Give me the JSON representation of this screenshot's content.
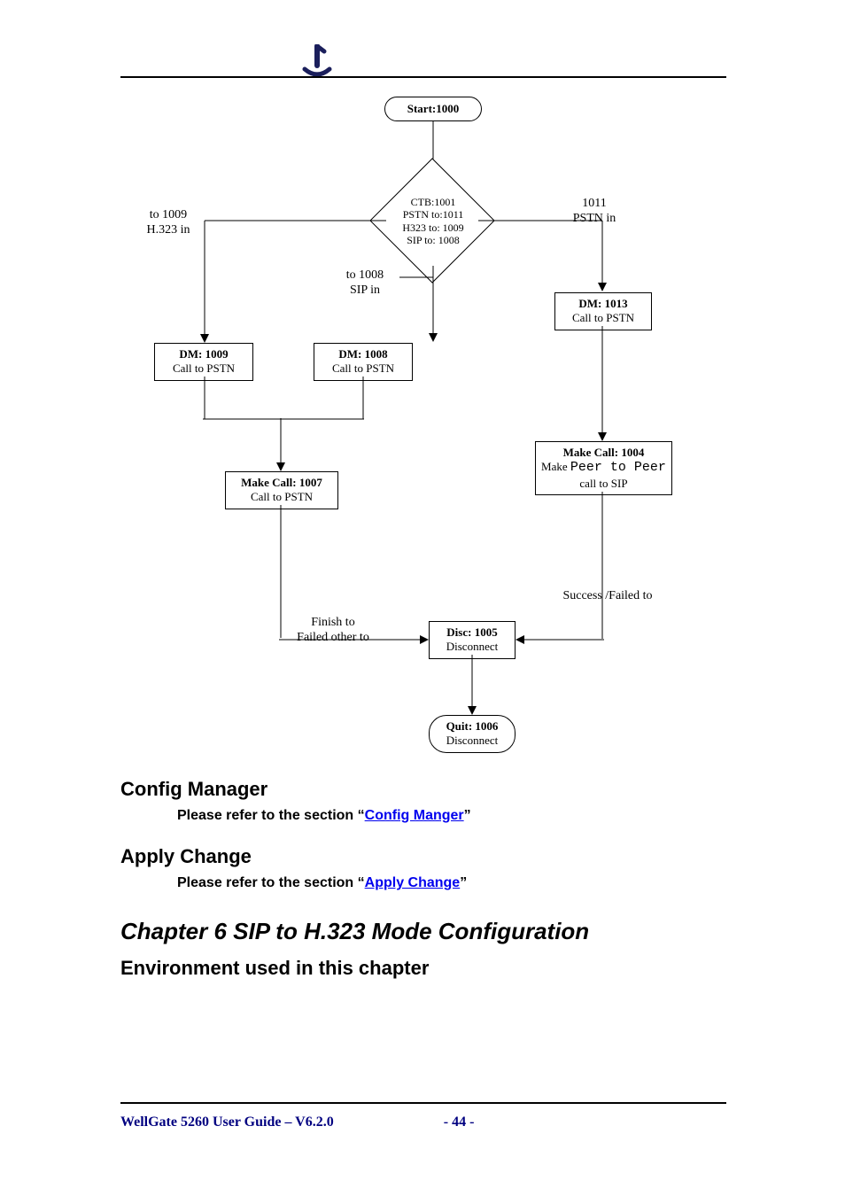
{
  "diagram": {
    "start": {
      "l1": "Start:1000"
    },
    "ctb": {
      "l1": "CTB:1001",
      "l2": "PSTN to:1011",
      "l3": "H323 to: 1009",
      "l4": "SIP to: 1008"
    },
    "to1009": {
      "l1": "to 1009",
      "l2": "H.323 in"
    },
    "to1008": {
      "l1": "to 1008",
      "l2": "SIP in"
    },
    "pstn1011": {
      "l1": "1011",
      "l2": "PSTN in"
    },
    "dm1013": {
      "l1": "DM: 1013",
      "l2": "Call to PSTN"
    },
    "dm1009": {
      "l1": "DM: 1009",
      "l2": "Call to PSTN"
    },
    "dm1008": {
      "l1": "DM: 1008",
      "l2": "Call to PSTN"
    },
    "make1004": {
      "l1": "Make Call: 1004",
      "l2a": "Make",
      "l2b": "Peer to Peer",
      "l3": "call to SIP"
    },
    "make1007": {
      "l1": "Make Call: 1007",
      "l2": "Call to PSTN"
    },
    "finish": {
      "l1": "Finish to",
      "l2": "Failed other to"
    },
    "disc1005": {
      "l1": "Disc: 1005",
      "l2": "Disconnect"
    },
    "quit1006": {
      "l1": "Quit: 1006",
      "l2": "Disconnect"
    },
    "success": {
      "l1": "Success /Failed to"
    }
  },
  "sections": {
    "config_manager_h": "Config Manager",
    "config_manager_pre": "Please refer to the section “",
    "config_manager_link": "Config Manger",
    "config_manager_post": "”",
    "apply_change_h": "Apply Change",
    "apply_change_pre": "Please refer to the section “",
    "apply_change_link": "Apply Change",
    "apply_change_post": "”",
    "chapter_h": "Chapter 6 SIP to H.323 Mode Configuration",
    "env_h": "Environment used in this chapter"
  },
  "footer": {
    "guide": "WellGate 5260 User Guide – V6.2.0",
    "page": "- 44 -"
  }
}
